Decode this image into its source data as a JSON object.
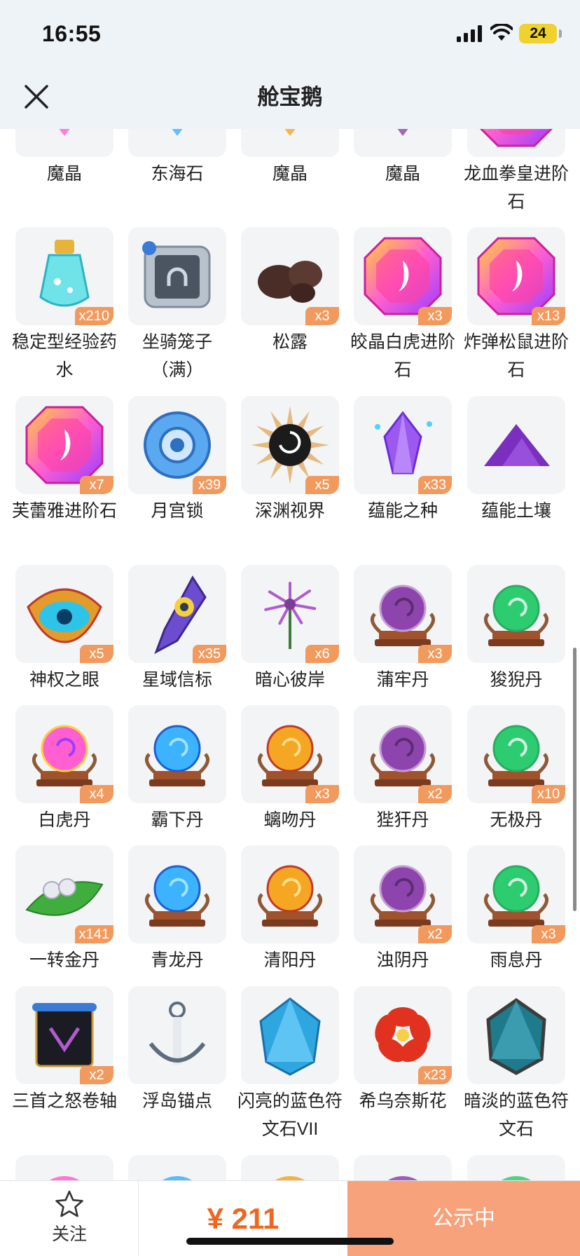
{
  "status_bar": {
    "time": "16:55",
    "battery": "24"
  },
  "nav": {
    "title": "舱宝鹅"
  },
  "items": [
    {
      "name": "魔晶",
      "qty": "",
      "icon": "magic-crystal-icon"
    },
    {
      "name": "东海石",
      "qty": "",
      "icon": "donghai-stone-icon"
    },
    {
      "name": "魔晶",
      "qty": "",
      "icon": "magic-crystal-icon"
    },
    {
      "name": "魔晶",
      "qty": "",
      "icon": "magic-crystal-icon"
    },
    {
      "name": "龙血拳皇进阶石",
      "qty": "",
      "icon": "advance-stone-icon"
    },
    {
      "name": "稳定型经验药水",
      "qty": "x210",
      "icon": "exp-potion-icon"
    },
    {
      "name": "坐骑笼子（满）",
      "qty": "",
      "icon": "mount-cage-icon"
    },
    {
      "name": "松露",
      "qty": "x3",
      "icon": "truffle-icon"
    },
    {
      "name": "皎晶白虎进阶石",
      "qty": "x3",
      "icon": "advance-stone-icon"
    },
    {
      "name": "炸弹松鼠进阶石",
      "qty": "x13",
      "icon": "advance-stone-icon"
    },
    {
      "name": "芙蕾雅进阶石",
      "qty": "x7",
      "icon": "advance-stone-icon"
    },
    {
      "name": "月宫锁",
      "qty": "x39",
      "icon": "moon-lock-icon"
    },
    {
      "name": "深渊视界",
      "qty": "x5",
      "icon": "abyss-vision-icon"
    },
    {
      "name": "蕴能之种",
      "qty": "x33",
      "icon": "energy-seed-icon"
    },
    {
      "name": "蕴能土壤",
      "qty": "",
      "icon": "energy-soil-icon"
    },
    {
      "name": "神权之眼",
      "qty": "x5",
      "icon": "divine-eye-icon"
    },
    {
      "name": "星域信标",
      "qty": "x35",
      "icon": "star-beacon-icon"
    },
    {
      "name": "暗心彼岸",
      "qty": "x6",
      "icon": "dark-flower-icon"
    },
    {
      "name": "蒲牢丹",
      "qty": "x3",
      "icon": "orb-pill-icon"
    },
    {
      "name": "狻猊丹",
      "qty": "",
      "icon": "orb-pill-icon"
    },
    {
      "name": "白虎丹",
      "qty": "x4",
      "icon": "orb-pill-icon"
    },
    {
      "name": "霸下丹",
      "qty": "",
      "icon": "orb-pill-icon"
    },
    {
      "name": "螭吻丹",
      "qty": "x3",
      "icon": "orb-pill-icon"
    },
    {
      "name": "狴犴丹",
      "qty": "x2",
      "icon": "orb-pill-icon"
    },
    {
      "name": "无极丹",
      "qty": "x10",
      "icon": "orb-pill-icon"
    },
    {
      "name": "一转金丹",
      "qty": "x141",
      "icon": "leaf-pill-icon"
    },
    {
      "name": "青龙丹",
      "qty": "",
      "icon": "orb-pill-icon"
    },
    {
      "name": "清阳丹",
      "qty": "",
      "icon": "orb-pill-icon"
    },
    {
      "name": "浊阴丹",
      "qty": "x2",
      "icon": "orb-pill-icon"
    },
    {
      "name": "雨息丹",
      "qty": "x3",
      "icon": "orb-pill-icon"
    },
    {
      "name": "三首之怒卷轴",
      "qty": "x2",
      "icon": "scroll-icon"
    },
    {
      "name": "浮岛锚点",
      "qty": "",
      "icon": "anchor-icon"
    },
    {
      "name": "闪亮的蓝色符文石VII",
      "qty": "",
      "icon": "blue-rune-icon"
    },
    {
      "name": "希乌奈斯花",
      "qty": "x23",
      "icon": "red-flower-icon"
    },
    {
      "name": "暗淡的蓝色符文石",
      "qty": "",
      "icon": "dark-rune-icon"
    },
    {
      "name": "",
      "qty": "",
      "icon": "item-icon"
    },
    {
      "name": "",
      "qty": "",
      "icon": "item-icon"
    },
    {
      "name": "",
      "qty": "",
      "icon": "item-icon"
    },
    {
      "name": "",
      "qty": "",
      "icon": "item-icon"
    },
    {
      "name": "",
      "qty": "",
      "icon": "item-icon"
    }
  ],
  "bottom": {
    "follow_label": "关注",
    "price": "¥ 211",
    "status_button": "公示中"
  },
  "colors": {
    "accent": "#f0661e",
    "badge": "#f29a5e",
    "status_button": "#f7a27a",
    "header_bg": "#eef3f7"
  }
}
